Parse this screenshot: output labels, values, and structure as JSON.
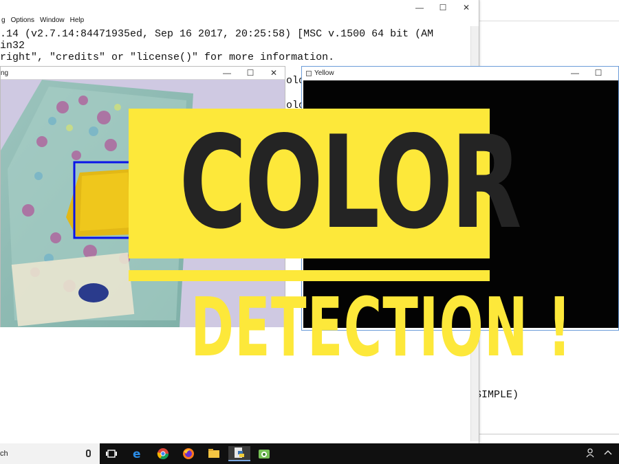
{
  "shell": {
    "menu": [
      "g",
      "Options",
      "Window",
      "Help"
    ],
    "lines": [
      ".14 (v2.7.14:84471935ed, Sep 16 2017, 20:25:58) [MSC v.1500 64 bit (AM",
      "in32",
      "right\", \"credits\" or \"license()\" for more information.",
      "olo",
      "olo"
    ],
    "controls": [
      "—",
      "☐",
      "✕"
    ]
  },
  "bg_window": {
    "code": "SIMPLE)"
  },
  "camera_window": {
    "title": "ng",
    "controls": [
      "—",
      "☐",
      "✕"
    ]
  },
  "yellow_window": {
    "title": "Yellow",
    "controls": [
      "—",
      "☐"
    ]
  },
  "banner": {
    "line1": "COLOR",
    "line2": "DETECTION !",
    "bg_color": "#fde83a",
    "text_color": "#242424"
  },
  "taskbar": {
    "search_text": "ch",
    "icons": [
      "task-view-icon",
      "edge-icon",
      "chrome-icon",
      "firefox-icon",
      "file-explorer-icon",
      "python-idle-icon",
      "android-studio-icon"
    ]
  }
}
